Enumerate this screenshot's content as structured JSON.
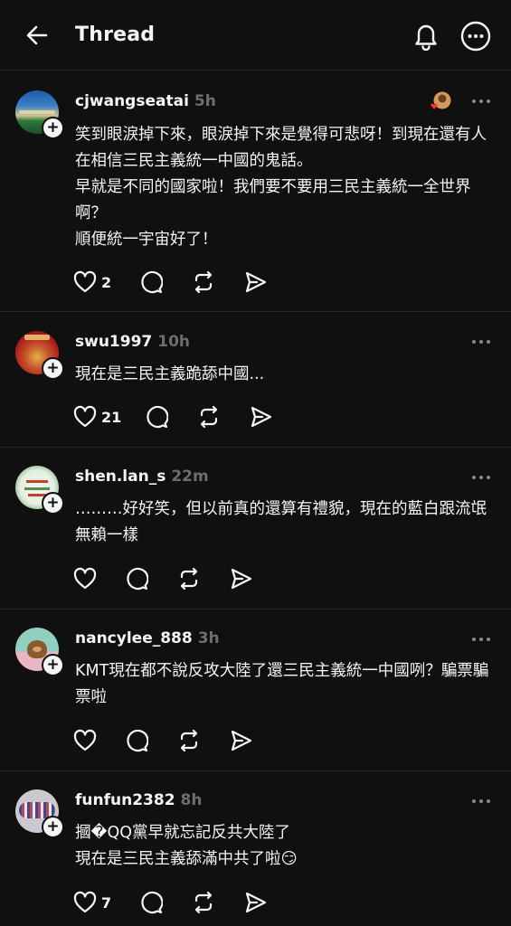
{
  "header": {
    "title": "Thread"
  },
  "posts": [
    {
      "username": "cjwangseatai",
      "time": "5h",
      "text": "笑到眼淚掉下來，眼淚掉下來是覺得可悲呀！到現在還有人在相信三民主義統一中國的鬼話。\n早就是不同的國家啦！我們要不要用三民主義統一全世界啊？\n順便統一宇宙好了！",
      "likes": "2",
      "avatar_color": "#2a5b9c"
    },
    {
      "username": "swu1997",
      "time": "10h",
      "text": "現在是三民主義跪舔中國...",
      "likes": "21",
      "avatar_color": "#b31e1e"
    },
    {
      "username": "shen.lan_s",
      "time": "22m",
      "text": "………好好笑，但以前真的還算有禮貌，現在的藍白跟流氓無賴一樣",
      "likes": "",
      "avatar_color": "#e8efe6"
    },
    {
      "username": "nancylee_888",
      "time": "3h",
      "text": "KMT現在都不說反攻大陸了還三民主義統一中國咧？騙票騙票啦",
      "likes": "",
      "avatar_color": "#8fd0c0"
    },
    {
      "username": "funfun2382",
      "time": "8h",
      "text": "摑�QQ黨早就忘記反共大陸了\n現在是三民主義舔滿中共了啦😏",
      "likes": "7",
      "avatar_color": "#c9c9cf"
    }
  ],
  "icons": {
    "back": "arrow-left-icon",
    "bell": "bell-icon",
    "more": "more-circle-icon",
    "like": "heart-icon",
    "reply": "comment-icon",
    "repost": "repost-icon",
    "share": "send-icon"
  },
  "colors": {
    "background": "#101010",
    "text": "#f3f5f7",
    "muted": "#6e6e6e",
    "divider": "#262626"
  }
}
